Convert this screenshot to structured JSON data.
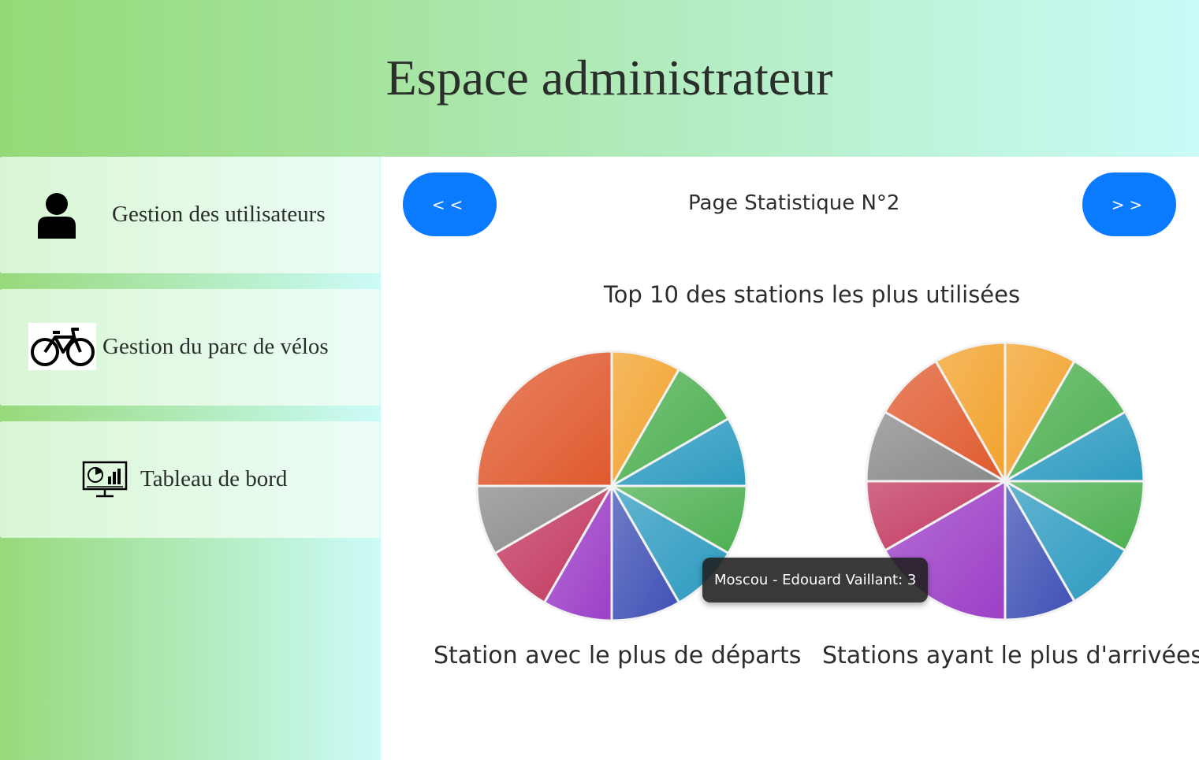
{
  "header": {
    "title": "Espace administrateur"
  },
  "sidebar": {
    "items": [
      {
        "label": "Gestion des utilisateurs",
        "icon": "user-icon"
      },
      {
        "label": "Gestion du parc de vélos",
        "icon": "bicycle-icon"
      },
      {
        "label": "Tableau de bord",
        "icon": "dashboard-icon"
      }
    ]
  },
  "main": {
    "prev_label": "<<",
    "next_label": ">>",
    "page_title": "Page Statistique N°2",
    "section_title": "Top 10 des stations les plus utilisées"
  },
  "tooltip": {
    "text": "Moscou - Edouard Vaillant: 3"
  },
  "colors": {
    "button": "#0a7bff",
    "slices": [
      "#2e9bc0",
      "#4caf50",
      "#3f51b5",
      "#9c3fc7",
      "#c2385f",
      "#8a8a8a",
      "#e05a2e",
      "#f2a22c"
    ]
  },
  "chart_data": [
    {
      "type": "pie",
      "title": "Station avec le plus de départs",
      "values": [
        1,
        1,
        1,
        1,
        1,
        1,
        1,
        1,
        1,
        3
      ],
      "slice_colors": [
        "#f2a22c",
        "#4caf50",
        "#2e9bc0",
        "#4caf50",
        "#2e9bc0",
        "#3f51b5",
        "#9c3fc7",
        "#c2385f",
        "#8a8a8a",
        "#e05a2e"
      ],
      "slice_order_start": "top, clockwise",
      "large_slice_index": 9
    },
    {
      "type": "pie",
      "title": "Stations ayant le plus d'arrivées",
      "values": [
        1,
        1,
        1,
        1,
        1,
        1,
        2,
        1,
        1,
        1,
        1
      ],
      "slice_colors": [
        "#f2a22c",
        "#4caf50",
        "#2e9bc0",
        "#4caf50",
        "#2e9bc0",
        "#3f51b5",
        "#9c3fc7",
        "#c2385f",
        "#8a8a8a",
        "#e05a2e"
      ]
    }
  ]
}
